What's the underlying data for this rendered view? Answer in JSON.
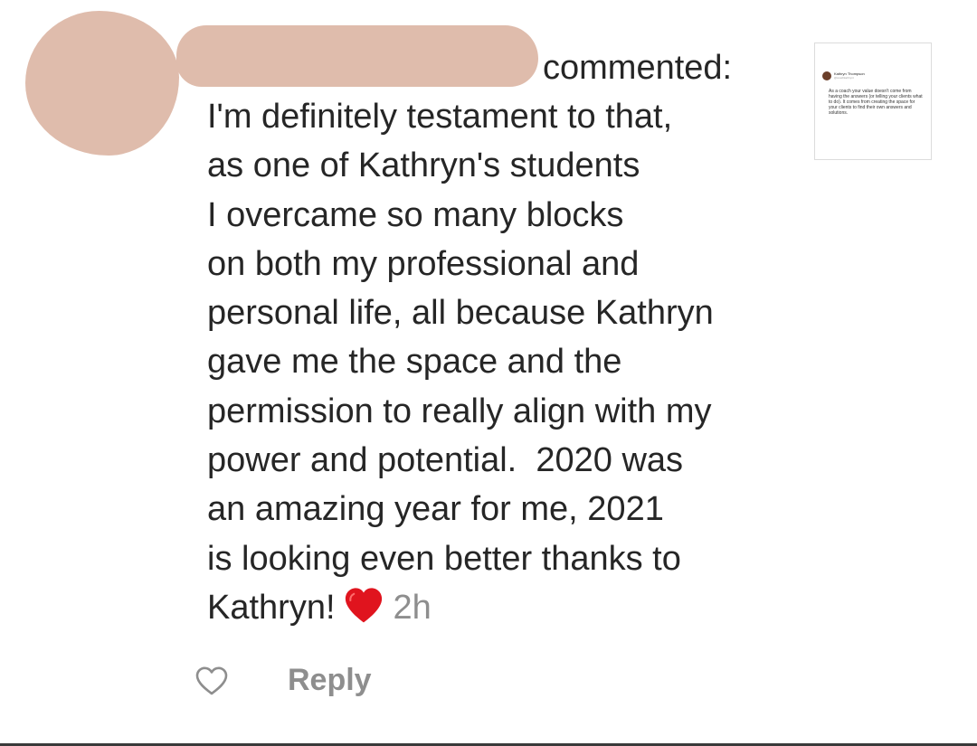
{
  "comment": {
    "action_label": "commented:",
    "lines": [
      "I'm definitely testament to that,",
      "as one of Kathryn's students",
      "I overcame so many blocks",
      "on both my professional and",
      "personal life, all because Kathryn",
      "gave me the space and the",
      "permission to really align with my",
      "power and potential.  2020 was",
      "an amazing year for me, 2021",
      "is looking even better thanks to",
      "Kathryn!"
    ],
    "timestamp": "2h"
  },
  "post_thumbnail": {
    "author": "Kathryn Thompson",
    "handle": "@coachkathrynt",
    "text": "As a coach your value doesn't come from having the answers (or telling your clients what to do). It comes from creating the space for your clients to find their own answers and solutions."
  },
  "actions": {
    "like_icon": "heart-outline-icon",
    "reply_label": "Reply"
  },
  "colors": {
    "text": "#262626",
    "muted": "#8e8e8e",
    "redaction": "#dfbcac",
    "heart": "#e0141e"
  }
}
